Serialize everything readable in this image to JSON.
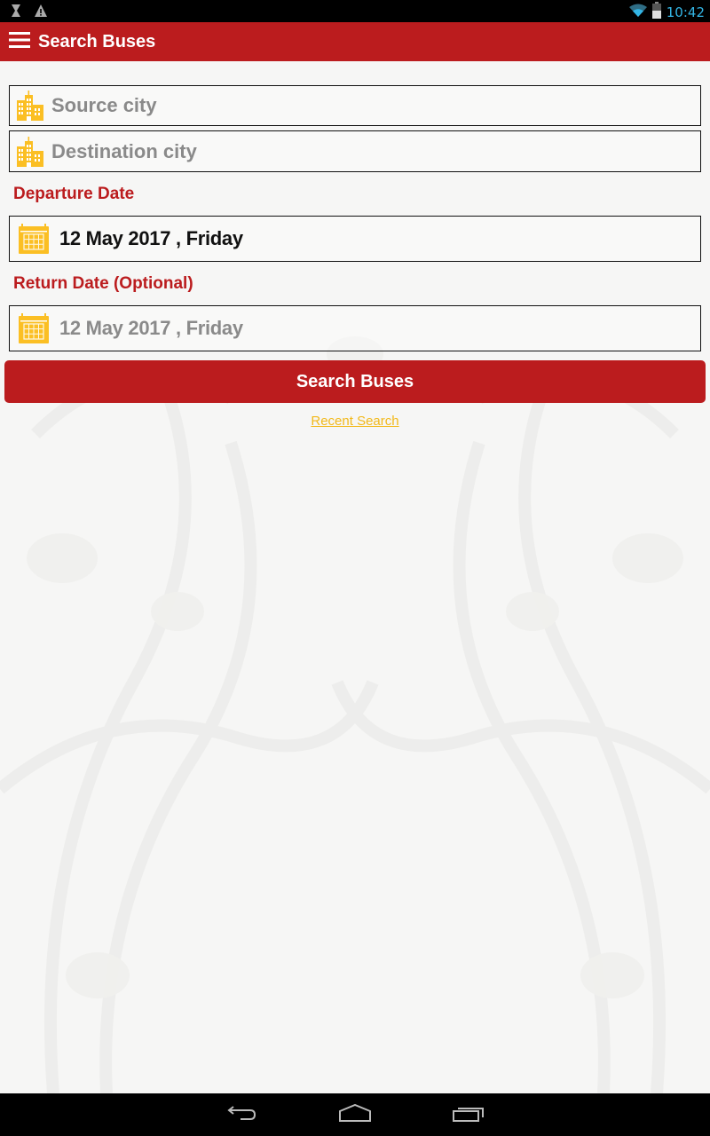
{
  "status_bar": {
    "left_icons": [
      "hourglass-icon",
      "warning-icon"
    ],
    "right_icons": [
      "wifi-icon",
      "battery-icon"
    ],
    "time": "10:42"
  },
  "app_bar": {
    "menu_icon": "hamburger-menu-icon",
    "title": "Search Buses"
  },
  "form": {
    "source": {
      "icon": "city-buildings-icon",
      "placeholder": "Source city",
      "value": ""
    },
    "destination": {
      "icon": "city-buildings-icon",
      "placeholder": "Destination city",
      "value": ""
    },
    "departure": {
      "label": "Departure Date",
      "icon": "calendar-icon",
      "value": "12 May 2017 , Friday"
    },
    "return": {
      "label": "Return Date (Optional)",
      "icon": "calendar-icon",
      "value": "12 May 2017 , Friday"
    },
    "search_button": "Search Buses",
    "recent_search_link": "Recent Search"
  },
  "nav_bar": {
    "buttons": [
      "back-icon",
      "home-icon",
      "recent-apps-icon"
    ]
  },
  "colors": {
    "primary": "#bb1c1e",
    "accent": "#f2b91b",
    "icon_yellow": "#fbbf24",
    "placeholder_text": "#8a8a8a",
    "status_blue": "#33b5e5"
  }
}
